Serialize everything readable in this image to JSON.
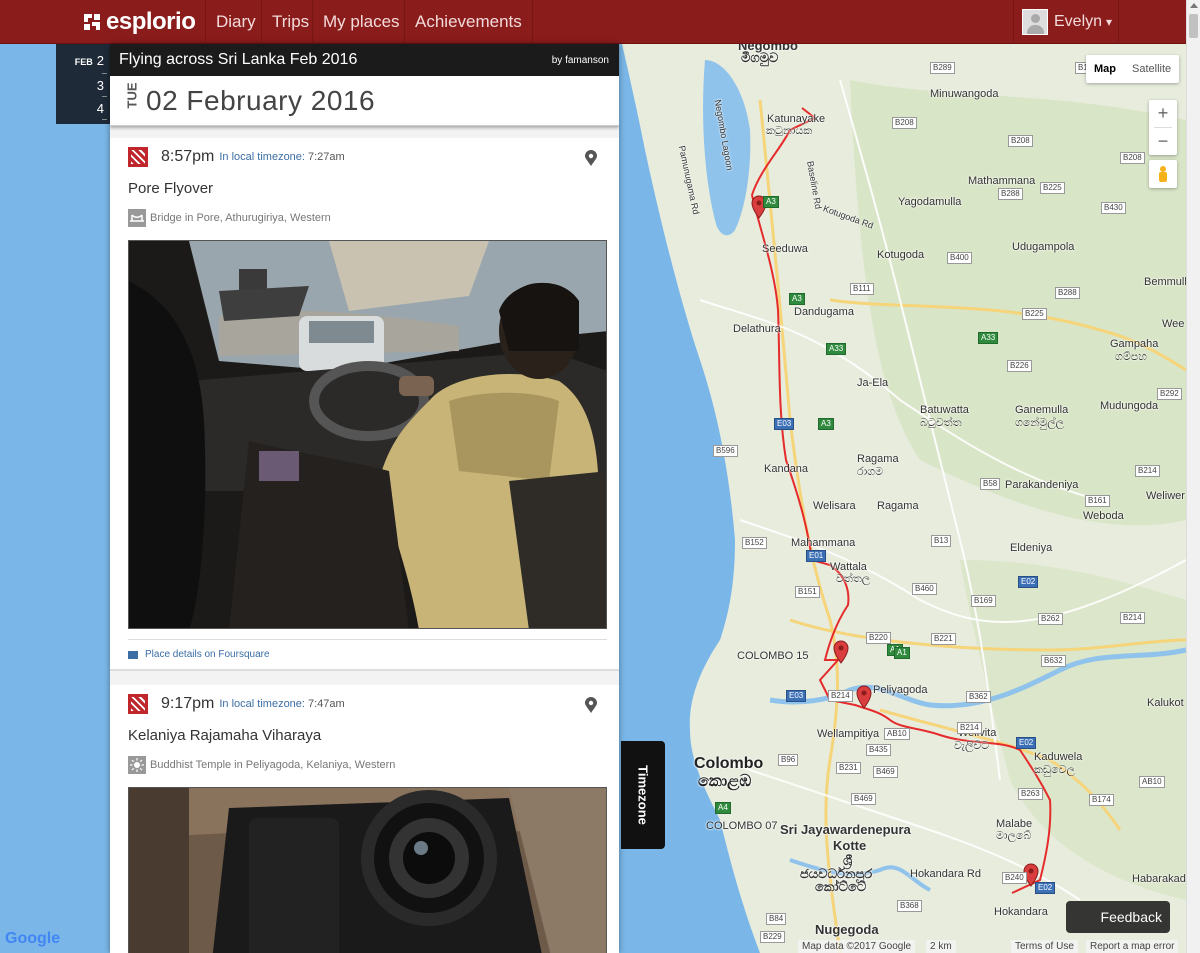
{
  "nav": {
    "brand": "esplorio",
    "items": [
      "Diary",
      "Trips",
      "My places",
      "Achievements"
    ],
    "user": "Evelyn",
    "user_caret": "▾"
  },
  "rail": {
    "month": "FEB",
    "days": [
      "2",
      "3",
      "4"
    ]
  },
  "trip": {
    "title": "Flying across Sri Lanka Feb 2016",
    "by": "by famanson"
  },
  "date_header": {
    "dow": "TUE",
    "date": "02 February 2016"
  },
  "entries": [
    {
      "time": "8:57pm",
      "tz_link": "In local timezone:",
      "tz_value": "7:27am",
      "title": "Pore Flyover",
      "place": "Bridge in Pore, Athurugiriya, Western",
      "place_icon": "bridge-icon",
      "foursquare": "Place details on Foursquare"
    },
    {
      "time": "9:17pm",
      "tz_link": "In local timezone:",
      "tz_value": "7:47am",
      "title": "Kelaniya Rajamaha Viharaya",
      "place": "Buddhist Temple in Peliyagoda, Kelaniya, Western",
      "place_icon": "temple-icon"
    }
  ],
  "timezone_tab": "Timezone",
  "map": {
    "type_map": "Map",
    "type_satellite": "Satellite",
    "zoom_in": "+",
    "zoom_out": "−",
    "google": "Google",
    "attribution": [
      "Map data ©2017 Google",
      "2 km",
      "Terms of Use",
      "Report a map error"
    ],
    "feedback": "Feedback",
    "labels": [
      {
        "text": "Negombo",
        "cls": "med"
      },
      {
        "text": "මීගමුව",
        "cls": "med"
      },
      {
        "text": "Katunayake",
        "cls": ""
      },
      {
        "text": "කටුනායක",
        "cls": ""
      },
      {
        "text": "Minuwangoda",
        "cls": ""
      },
      {
        "text": "Seeduwa",
        "cls": ""
      },
      {
        "text": "Mathammana",
        "cls": ""
      },
      {
        "text": "Yagodamulla",
        "cls": ""
      },
      {
        "text": "Kotugoda",
        "cls": ""
      },
      {
        "text": "Udugampola",
        "cls": ""
      },
      {
        "text": "Dandugama",
        "cls": ""
      },
      {
        "text": "Delathura",
        "cls": ""
      },
      {
        "text": "Bemmull",
        "cls": ""
      },
      {
        "text": "Wee",
        "cls": ""
      },
      {
        "text": "Gampaha",
        "cls": ""
      },
      {
        "text": "ගම්පහ",
        "cls": ""
      },
      {
        "text": "Ja-Ela",
        "cls": ""
      },
      {
        "text": "Batuwatta",
        "cls": ""
      },
      {
        "text": "බටුවත්ත",
        "cls": ""
      },
      {
        "text": "Ganemulla",
        "cls": ""
      },
      {
        "text": "ගනේමුල්ල",
        "cls": ""
      },
      {
        "text": "Mudungoda",
        "cls": ""
      },
      {
        "text": "Kandana",
        "cls": ""
      },
      {
        "text": "Ragama",
        "cls": ""
      },
      {
        "text": "රාගම",
        "cls": ""
      },
      {
        "text": "Parakandeniya",
        "cls": ""
      },
      {
        "text": "Welisara",
        "cls": ""
      },
      {
        "text": "Ragama",
        "cls": ""
      },
      {
        "text": "Weboda",
        "cls": ""
      },
      {
        "text": "Weliwer",
        "cls": ""
      },
      {
        "text": "Mahammana",
        "cls": ""
      },
      {
        "text": "Eldeniya",
        "cls": ""
      },
      {
        "text": "Wattala",
        "cls": ""
      },
      {
        "text": "වත්තල",
        "cls": ""
      },
      {
        "text": "Peliyagoda",
        "cls": ""
      },
      {
        "text": "COLOMBO 15",
        "cls": ""
      },
      {
        "text": "Kalukot",
        "cls": ""
      },
      {
        "text": "Wellampitiya",
        "cls": ""
      },
      {
        "text": "Welivita",
        "cls": ""
      },
      {
        "text": "වැලිවිට",
        "cls": ""
      },
      {
        "text": "Kaduwela",
        "cls": ""
      },
      {
        "text": "කඩුවෙල",
        "cls": ""
      },
      {
        "text": "Colombo",
        "cls": "big"
      },
      {
        "text": "කොළඹ",
        "cls": "big"
      },
      {
        "text": "COLOMBO 07",
        "cls": ""
      },
      {
        "text": "Sri Jayawardenepura",
        "cls": "med"
      },
      {
        "text": "Kotte",
        "cls": "med"
      },
      {
        "text": "ශ්‍රී",
        "cls": "med"
      },
      {
        "text": "ජයවර්ධනපුර",
        "cls": "med"
      },
      {
        "text": "කෝට්ටේ",
        "cls": "med"
      },
      {
        "text": "Malabe",
        "cls": ""
      },
      {
        "text": "මාලබේ",
        "cls": ""
      },
      {
        "text": "Habarakad",
        "cls": ""
      },
      {
        "text": "Hokandara",
        "cls": ""
      },
      {
        "text": "Nugegoda",
        "cls": "med"
      },
      {
        "text": "Hokandara Rd",
        "cls": ""
      },
      {
        "text": "Negombo Lagoon",
        "cls": ""
      },
      {
        "text": "Pamunugama Rd",
        "cls": ""
      },
      {
        "text": "Kotugoda Rd",
        "cls": ""
      },
      {
        "text": "Baseline Rd",
        "cls": ""
      }
    ],
    "shields": [
      "B289",
      "B111",
      "B208",
      "B208",
      "B208",
      "B288",
      "B225",
      "B430",
      "A3",
      "B400",
      "B111",
      "B288",
      "A3",
      "B225",
      "A33",
      "A33",
      "B226",
      "B292",
      "E03",
      "A3",
      "B596",
      "B214",
      "B58",
      "B161",
      "B152",
      "E01",
      "B13",
      "B460",
      "E02",
      "B151",
      "B169",
      "B214",
      "B262",
      "A1",
      "B221",
      "B220",
      "B632",
      "A1",
      "B214",
      "E03",
      "B362",
      "AB10",
      "B214",
      "E02",
      "B435",
      "B96",
      "B231",
      "B469",
      "B469",
      "AB10",
      "B263",
      "B174",
      "A4",
      "B240",
      "E02",
      "B84",
      "B229",
      "B368"
    ]
  }
}
